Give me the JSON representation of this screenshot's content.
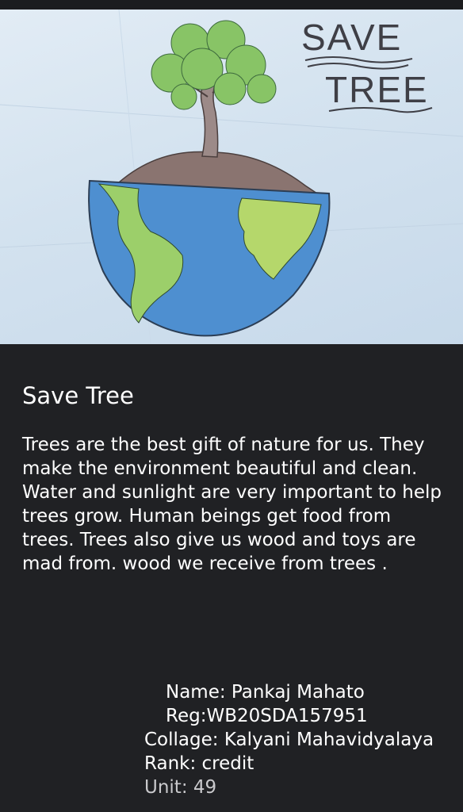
{
  "image": {
    "drawing_text_line1": "SAVE",
    "drawing_text_line2": "TREE"
  },
  "post": {
    "title": "Save Tree",
    "body": "Trees are the best gift of nature for us. They make the environment beautiful and clean. Water and sunlight are very important to help trees grow. Human beings get food from trees. Trees also give us wood and toys are mad from. wood we receive from trees ."
  },
  "author": {
    "name_line": "Name: Pankaj Mahato",
    "reg_line": "Reg:WB20SDA157951",
    "college_line": "Collage: Kalyani Mahavidyalaya",
    "rank_line": "Rank: credit",
    "unit_line": "Unit: 49"
  },
  "colors": {
    "background": "#202124",
    "text": "#ffffff",
    "paper": "#d3e2ef"
  }
}
